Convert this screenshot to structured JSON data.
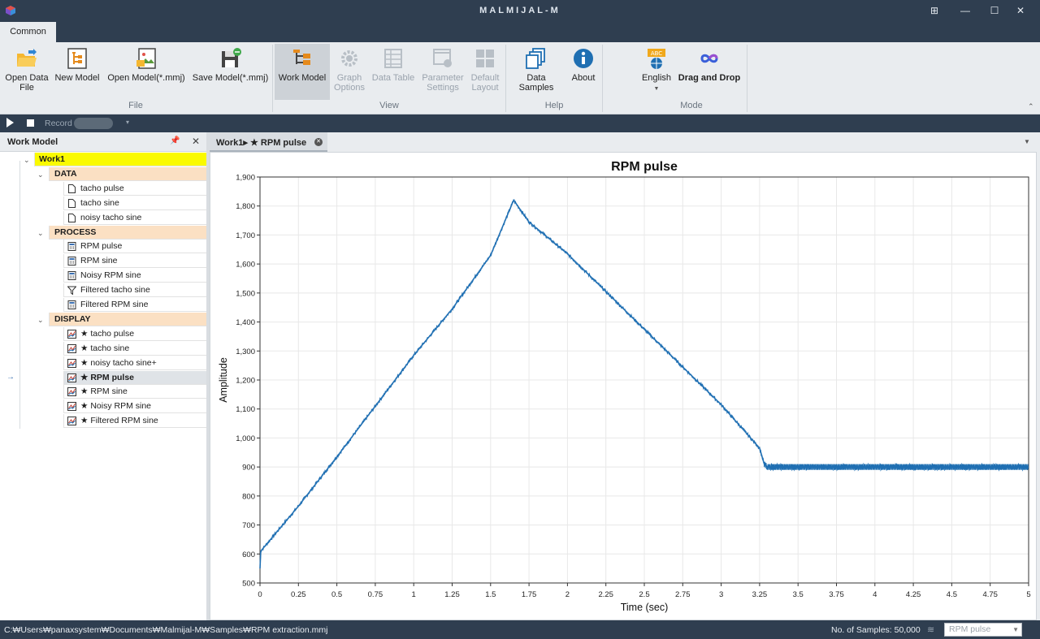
{
  "app": {
    "title": "MALMIJAL-M"
  },
  "tabs": {
    "active": "Common"
  },
  "ribbon": {
    "file": {
      "group_label": "File",
      "open_data_file": "Open Data\nFile",
      "new_model": "New Model",
      "open_model": "Open Model(*.mmj)",
      "save_model": "Save Model(*.mmj)"
    },
    "view": {
      "group_label": "View",
      "work_model": "Work Model",
      "graph_options": "Graph\nOptions",
      "data_table": "Data Table",
      "parameter_settings": "Parameter\nSettings",
      "default_layout": "Default\nLayout"
    },
    "help": {
      "group_label": "Help",
      "data_samples": "Data Samples",
      "about": "About"
    },
    "mode": {
      "group_label": "Mode",
      "language": "English",
      "drag_and_drop": "Drag and Drop"
    }
  },
  "toolbar": {
    "record_label": "Record"
  },
  "work_model_panel": {
    "title": "Work Model",
    "root": "Work1",
    "groups": [
      {
        "label": "DATA",
        "items": [
          {
            "label": "tacho pulse",
            "icon": "file-icon"
          },
          {
            "label": "tacho sine",
            "icon": "file-icon"
          },
          {
            "label": "noisy tacho sine",
            "icon": "file-icon"
          }
        ]
      },
      {
        "label": "PROCESS",
        "items": [
          {
            "label": "RPM pulse",
            "icon": "calculator-icon"
          },
          {
            "label": "RPM sine",
            "icon": "calculator-icon"
          },
          {
            "label": "Noisy RPM sine",
            "icon": "calculator-icon"
          },
          {
            "label": "Filtered tacho sine",
            "icon": "filter-icon"
          },
          {
            "label": "Filtered RPM sine",
            "icon": "calculator-icon"
          }
        ]
      },
      {
        "label": "DISPLAY",
        "items": [
          {
            "label": "★ tacho pulse",
            "icon": "chart-icon"
          },
          {
            "label": "★ tacho sine",
            "icon": "chart-icon"
          },
          {
            "label": "★ noisy tacho sine+",
            "icon": "chart-icon"
          },
          {
            "label": "★ RPM pulse",
            "icon": "chart-icon",
            "selected": true
          },
          {
            "label": "★ RPM sine",
            "icon": "chart-icon"
          },
          {
            "label": "★ Noisy RPM sine",
            "icon": "chart-icon"
          },
          {
            "label": "★ Filtered RPM sine",
            "icon": "chart-icon"
          }
        ]
      }
    ]
  },
  "document_tab": {
    "label": "Work1▸ ★ RPM pulse"
  },
  "chart_data": {
    "type": "line",
    "title": "RPM pulse",
    "xlabel": "Time (sec)",
    "ylabel": "Amplitude",
    "xlim": [
      0,
      5
    ],
    "ylim": [
      500,
      1900
    ],
    "xticks": [
      "0",
      "0.25",
      "0.5",
      "0.75",
      "1",
      "1.25",
      "1.5",
      "1.75",
      "2",
      "2.25",
      "2.5",
      "2.75",
      "3",
      "3.25",
      "3.5",
      "3.75",
      "4",
      "4.25",
      "4.5",
      "4.75",
      "5"
    ],
    "yticks": [
      "500",
      "600",
      "700",
      "800",
      "900",
      "1,000",
      "1,100",
      "1,200",
      "1,300",
      "1,400",
      "1,500",
      "1,600",
      "1,700",
      "1,800",
      "1,900"
    ],
    "grid": true,
    "series": [
      {
        "color": "#1f6fb2",
        "x": [
          0,
          0.005,
          0.25,
          0.5,
          0.75,
          1.0,
          1.25,
          1.5,
          1.65,
          1.75,
          2.0,
          2.25,
          2.5,
          2.75,
          3.0,
          3.25,
          3.28,
          3.3,
          5.0
        ],
        "y": [
          550,
          610,
          765,
          935,
          1110,
          1285,
          1445,
          1630,
          1820,
          1745,
          1635,
          1505,
          1375,
          1245,
          1115,
          965,
          910,
          900,
          900
        ]
      }
    ]
  },
  "status": {
    "path": "C:₩Users₩panaxsystem₩Documents₩Malmijal-M₩Samples₩RPM extraction.mmj",
    "samples": "No. of Samples: 50,000",
    "combo_value": "RPM pulse"
  }
}
